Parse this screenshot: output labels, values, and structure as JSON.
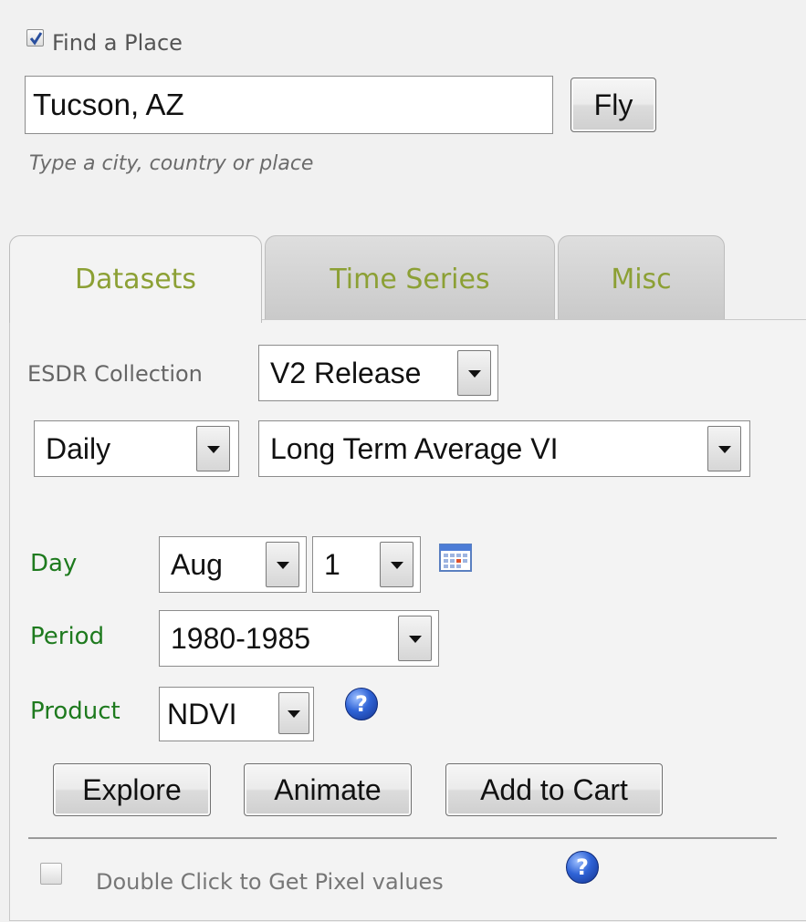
{
  "find_place": {
    "checkbox_checked": true,
    "label": "Find a Place",
    "input_value": "Tucson, AZ",
    "fly_button": "Fly",
    "hint": "Type a city, country or place"
  },
  "tabs": [
    {
      "label": "Datasets",
      "active": true
    },
    {
      "label": "Time Series",
      "active": false
    },
    {
      "label": "Misc",
      "active": false
    }
  ],
  "datasets": {
    "collection_label": "ESDR Collection",
    "collection_value": "V2 Release",
    "interval_value": "Daily",
    "dataset_value": "Long Term Average VI",
    "day_label": "Day",
    "month_value": "Aug",
    "day_value": "1",
    "calendar_icon": "calendar-icon",
    "period_label": "Period",
    "period_value": "1980-1985",
    "product_label": "Product",
    "product_value": "NDVI",
    "help_glyph": "?",
    "buttons": {
      "explore": "Explore",
      "animate": "Animate",
      "add_to_cart": "Add to Cart"
    },
    "pixel_checkbox_checked": false,
    "pixel_label": "Double Click to Get Pixel values"
  },
  "colors": {
    "tab_text": "#8ca035",
    "field_label_green": "#1e7a1e",
    "help_icon": "#2f63d6"
  }
}
